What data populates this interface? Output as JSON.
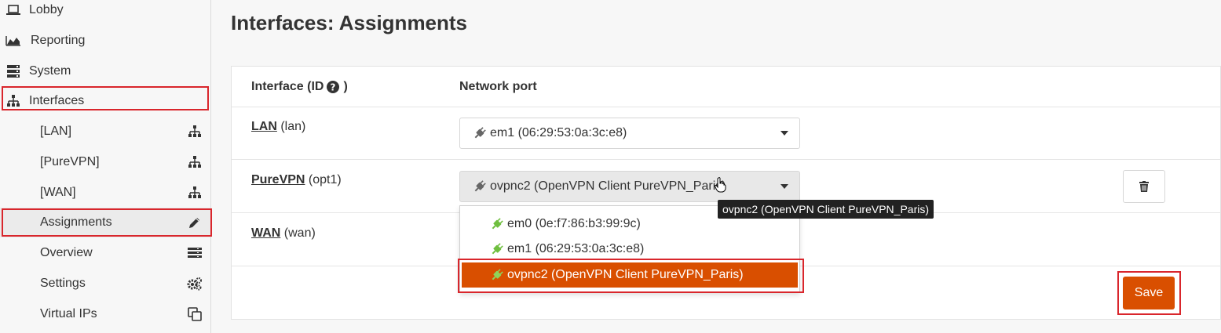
{
  "sidebar": {
    "items": [
      {
        "label": "Lobby",
        "icon": "laptop-icon"
      },
      {
        "label": "Reporting",
        "icon": "area-chart-icon"
      },
      {
        "label": "System",
        "icon": "server-icon"
      },
      {
        "label": "Interfaces",
        "icon": "sitemap-icon"
      }
    ],
    "sub_items": [
      {
        "label": "[LAN]",
        "icon": "sitemap-icon"
      },
      {
        "label": "[PureVPN]",
        "icon": "sitemap-icon"
      },
      {
        "label": "[WAN]",
        "icon": "sitemap-icon"
      },
      {
        "label": "Assignments",
        "icon": "pencil-icon"
      },
      {
        "label": "Overview",
        "icon": "list-icon"
      },
      {
        "label": "Settings",
        "icon": "cogs-icon"
      },
      {
        "label": "Virtual IPs",
        "icon": "copy-icon"
      }
    ]
  },
  "page": {
    "title": "Interfaces: Assignments"
  },
  "table": {
    "header_interface": "Interface (ID",
    "header_close": ")",
    "header_port": "Network port",
    "rows": [
      {
        "name": "LAN",
        "id": "(lan)",
        "port": "em1 (06:29:53:0a:3c:e8)"
      },
      {
        "name": "PureVPN",
        "id": "(opt1)",
        "port": "ovpnc2 (OpenVPN Client PureVPN_Paris)"
      },
      {
        "name": "WAN",
        "id": "(wan)",
        "port": ""
      }
    ]
  },
  "dropdown": {
    "options": [
      "em0 (0e:f7:86:b3:99:9c)",
      "em1 (06:29:53:0a:3c:e8)",
      "ovpnc2 (OpenVPN Client PureVPN_Paris)"
    ],
    "selected_index": 2
  },
  "tooltip": "ovpnc2 (OpenVPN Client PureVPN_Paris)",
  "buttons": {
    "save": "Save"
  },
  "colors": {
    "accent": "#d94f00",
    "highlight_border": "#d9262c",
    "plug_green": "#6fbf3f"
  }
}
